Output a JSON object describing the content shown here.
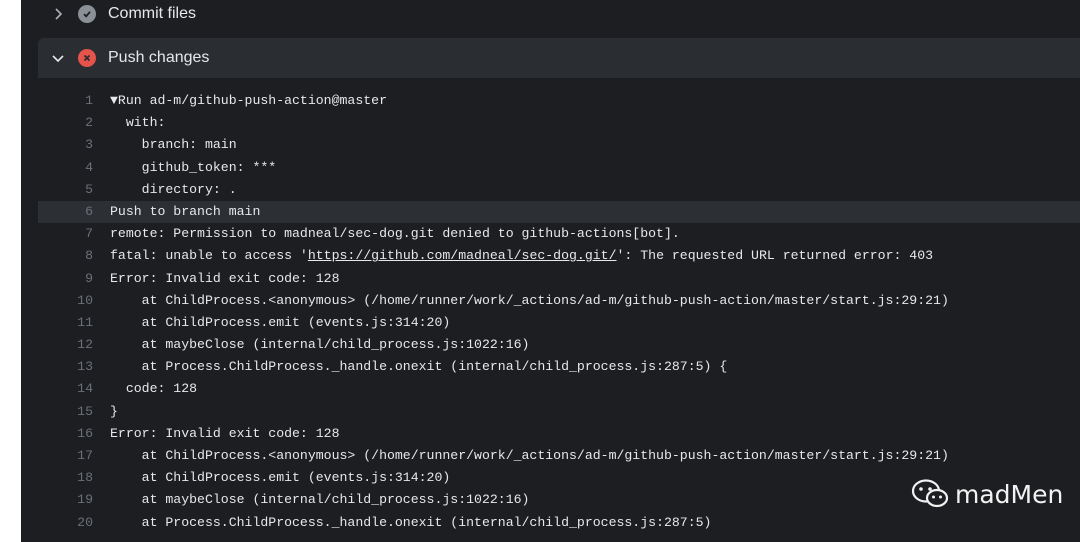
{
  "steps": {
    "commit": {
      "label": "Commit files",
      "status": "success",
      "expanded": false
    },
    "push": {
      "label": "Push changes",
      "status": "failure",
      "expanded": true
    }
  },
  "log": [
    {
      "n": "1",
      "text": "▼Run ad-m/github-push-action@master"
    },
    {
      "n": "2",
      "text": "  with:"
    },
    {
      "n": "3",
      "text": "    branch: main"
    },
    {
      "n": "4",
      "text": "    github_token: ***"
    },
    {
      "n": "5",
      "text": "    directory: ."
    },
    {
      "n": "6",
      "text": "Push to branch main"
    },
    {
      "n": "7",
      "text": "remote: Permission to madneal/sec-dog.git denied to github-actions[bot]."
    },
    {
      "n": "8",
      "pre": "fatal: unable to access '",
      "url": "https://github.com/madneal/sec-dog.git/",
      "post": "': The requested URL returned error: 403"
    },
    {
      "n": "9",
      "text": "Error: Invalid exit code: 128"
    },
    {
      "n": "10",
      "text": "    at ChildProcess.<anonymous> (/home/runner/work/_actions/ad-m/github-push-action/master/start.js:29:21)"
    },
    {
      "n": "11",
      "text": "    at ChildProcess.emit (events.js:314:20)"
    },
    {
      "n": "12",
      "text": "    at maybeClose (internal/child_process.js:1022:16)"
    },
    {
      "n": "13",
      "text": "    at Process.ChildProcess._handle.onexit (internal/child_process.js:287:5) {"
    },
    {
      "n": "14",
      "text": "  code: 128"
    },
    {
      "n": "15",
      "text": "}"
    },
    {
      "n": "16",
      "text": "Error: Invalid exit code: 128"
    },
    {
      "n": "17",
      "text": "    at ChildProcess.<anonymous> (/home/runner/work/_actions/ad-m/github-push-action/master/start.js:29:21)"
    },
    {
      "n": "18",
      "text": "    at ChildProcess.emit (events.js:314:20)"
    },
    {
      "n": "19",
      "text": "    at maybeClose (internal/child_process.js:1022:16)"
    },
    {
      "n": "20",
      "text": "    at Process.ChildProcess._handle.onexit (internal/child_process.js:287:5)"
    }
  ],
  "highlighted_line": "6",
  "watermark": {
    "text": "madMen",
    "icon": "wechat-icon"
  },
  "colors": {
    "background": "#1c1e22",
    "step_header": "#2a2d32",
    "success_icon": "#8b9097",
    "failure_icon": "#e5534b",
    "line_number": "#6b7078",
    "text": "#e6e8ea"
  }
}
